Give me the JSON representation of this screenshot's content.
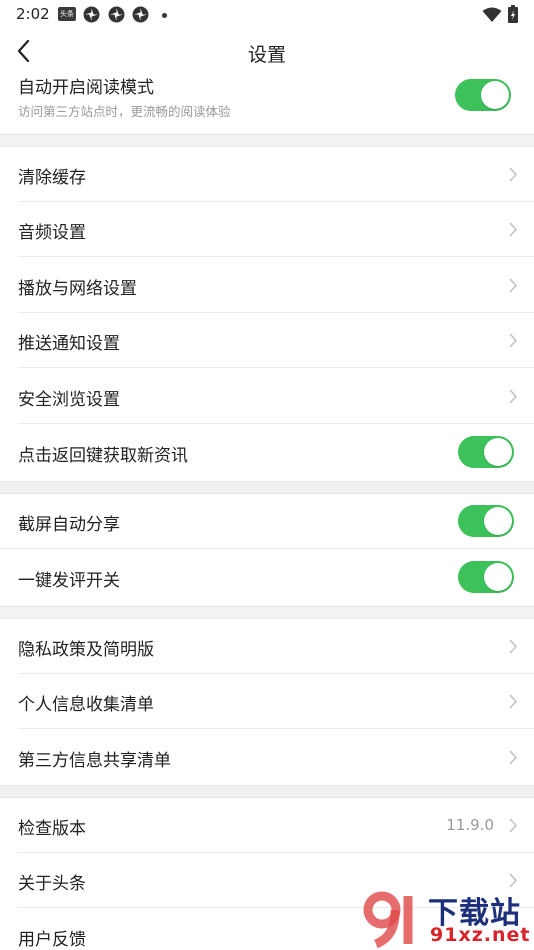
{
  "status_bar": {
    "time": "2:02",
    "badge": "头条"
  },
  "header": {
    "title": "设置"
  },
  "reading_mode": {
    "title": "自动开启阅读模式",
    "subtitle": "访问第三方站点时，更流畅的阅读体验",
    "enabled": true
  },
  "group1": [
    {
      "label": "清除缓存"
    },
    {
      "label": "音频设置"
    },
    {
      "label": "播放与网络设置"
    },
    {
      "label": "推送通知设置"
    },
    {
      "label": "安全浏览设置"
    },
    {
      "label": "点击返回键获取新资讯",
      "toggle": true
    }
  ],
  "group2": [
    {
      "label": "截屏自动分享",
      "toggle": true
    },
    {
      "label": "一键发评开关",
      "toggle": true
    }
  ],
  "group3": [
    {
      "label": "隐私政策及简明版"
    },
    {
      "label": "个人信息收集清单"
    },
    {
      "label": "第三方信息共享清单"
    }
  ],
  "group4": [
    {
      "label": "检查版本",
      "value": "11.9.0"
    },
    {
      "label": "关于头条"
    },
    {
      "label": "用户反馈"
    }
  ],
  "watermark": {
    "line1": "下载站",
    "line2": "91xz.net"
  },
  "colors": {
    "toggle_on": "#3cc15b",
    "gap_background": "#f2f2f2",
    "secondary_text": "#999999"
  }
}
